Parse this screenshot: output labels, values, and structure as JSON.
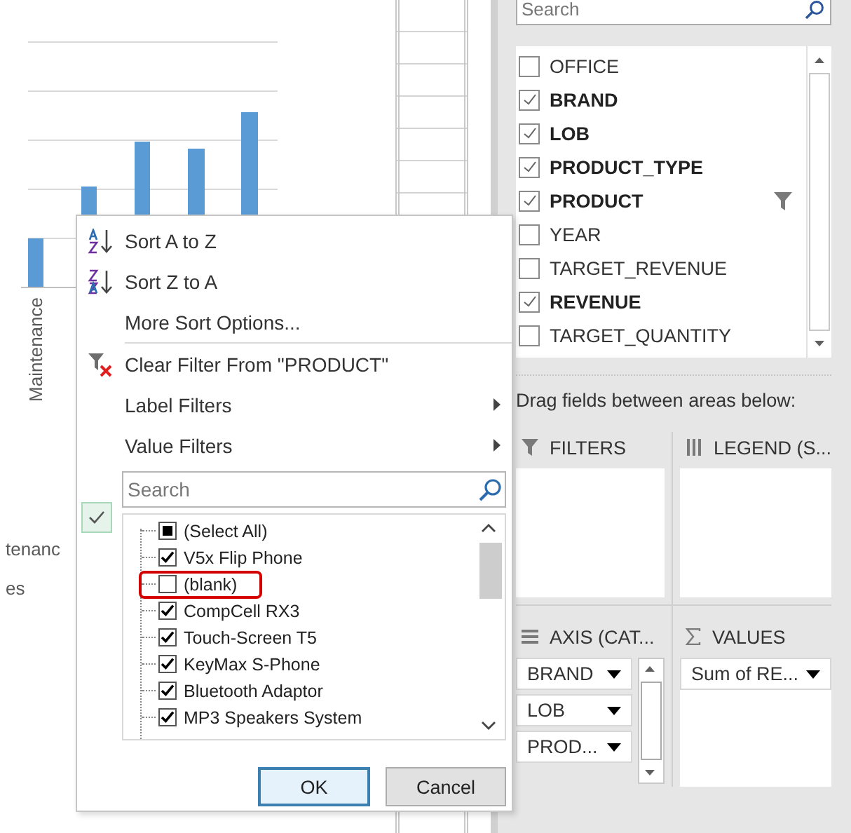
{
  "chart": {
    "category_label": "Maintenance",
    "partial_labels": [
      "tenanc",
      "es"
    ]
  },
  "field_pane": {
    "search": {
      "placeholder": "Search"
    },
    "fields": [
      {
        "name": "OFFICE",
        "checked": false,
        "filtered": false
      },
      {
        "name": "BRAND",
        "checked": true,
        "filtered": false
      },
      {
        "name": "LOB",
        "checked": true,
        "filtered": false
      },
      {
        "name": "PRODUCT_TYPE",
        "checked": true,
        "filtered": false
      },
      {
        "name": "PRODUCT",
        "checked": true,
        "filtered": true
      },
      {
        "name": "YEAR",
        "checked": false,
        "filtered": false
      },
      {
        "name": "TARGET_REVENUE",
        "checked": false,
        "filtered": false
      },
      {
        "name": "REVENUE",
        "checked": true,
        "filtered": false
      },
      {
        "name": "TARGET_QUANTITY",
        "checked": false,
        "filtered": false
      }
    ],
    "hint": "Drag fields between areas below:",
    "areas": [
      {
        "kind": "filters",
        "title": "FILTERS"
      },
      {
        "kind": "legend",
        "title": "LEGEND (S..."
      },
      {
        "kind": "axis",
        "title": "AXIS (CAT...",
        "items": [
          "BRAND",
          "LOB",
          "PROD..."
        ]
      },
      {
        "kind": "values",
        "title": "VALUES",
        "items": [
          "Sum of RE..."
        ]
      }
    ]
  },
  "filter_menu": {
    "items": [
      {
        "kind": "sort-az",
        "label": "Sort A to Z"
      },
      {
        "kind": "sort-za",
        "label": "Sort Z to A"
      },
      {
        "kind": "plain",
        "label": "More Sort Options..."
      },
      {
        "kind": "clear-filter",
        "label": "Clear Filter From \"PRODUCT\""
      },
      {
        "kind": "submenu",
        "label": "Label Filters"
      },
      {
        "kind": "submenu",
        "label": "Value Filters"
      }
    ],
    "search": {
      "placeholder": "Search"
    },
    "values": [
      {
        "label": "(Select All)",
        "partial": true,
        "highlighted": false
      },
      {
        "label": "V5x Flip Phone",
        "checked": true,
        "highlighted": false
      },
      {
        "label": "(blank)",
        "checked": false,
        "highlighted": true
      },
      {
        "label": "CompCell RX3",
        "checked": true,
        "highlighted": false
      },
      {
        "label": "Touch-Screen T5",
        "checked": true,
        "highlighted": false
      },
      {
        "label": "KeyMax S-Phone",
        "checked": true,
        "highlighted": false
      },
      {
        "label": "Bluetooth Adaptor",
        "checked": true,
        "highlighted": false
      },
      {
        "label": "MP3 Speakers System",
        "checked": true,
        "highlighted": false
      }
    ],
    "buttons": [
      {
        "label": "OK",
        "default": true
      },
      {
        "label": "Cancel",
        "default": false
      }
    ]
  }
}
